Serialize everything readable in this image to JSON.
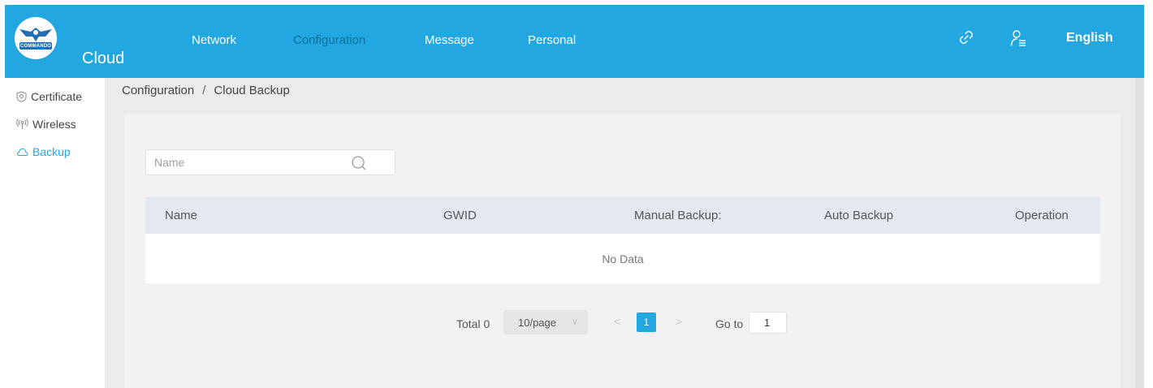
{
  "header": {
    "logo_text": "COMMANDO",
    "brand": "Cloud",
    "nav": [
      {
        "label": "Network",
        "active": false
      },
      {
        "label": "Configuration",
        "active": true
      },
      {
        "label": "Message",
        "active": false
      },
      {
        "label": "Personal",
        "active": false
      }
    ],
    "icons": [
      "link-icon",
      "user-list-icon"
    ],
    "language": "English"
  },
  "sidebar": {
    "items": [
      {
        "label": "Certificate",
        "icon": "shield-icon",
        "active": false
      },
      {
        "label": "Wireless",
        "icon": "wireless-icon",
        "active": false
      },
      {
        "label": "Backup",
        "icon": "cloud-icon",
        "active": true
      }
    ]
  },
  "breadcrumb": {
    "section": "Configuration",
    "separator": "/",
    "page": "Cloud Backup"
  },
  "search": {
    "placeholder": "Name",
    "value": ""
  },
  "table": {
    "columns": [
      "Name",
      "GWID",
      "Manual Backup:",
      "Auto Backup",
      "Operation"
    ],
    "rows": [],
    "empty_text": "No Data"
  },
  "pagination": {
    "total_label": "Total 0",
    "page_size": "10/page",
    "prev": "<",
    "current_page": "1",
    "next": ">",
    "goto_label": "Go to",
    "goto_value": "1"
  },
  "colors": {
    "accent": "#22a7e1",
    "active_nav": "#0b6f9c",
    "table_header": "#e4e9ef"
  }
}
